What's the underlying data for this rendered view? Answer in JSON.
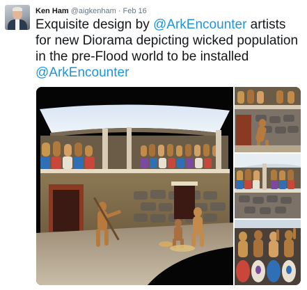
{
  "tweet": {
    "author_name": "Ken Ham",
    "author_handle": "@aigkenham",
    "separator": "·",
    "date": "Feb 16",
    "text_part1": "Exquisite design by ",
    "mention1": "@ArkEncounter",
    "text_part2": " artists for new Diorama  depicting wicked population in the pre-Flood world to be installed ",
    "mention2": "@ArkEncounter"
  },
  "colors": {
    "link": "#1b95e0",
    "meta": "#657786",
    "text": "#14171a"
  },
  "icons": {
    "avatar": "profile-photo"
  }
}
